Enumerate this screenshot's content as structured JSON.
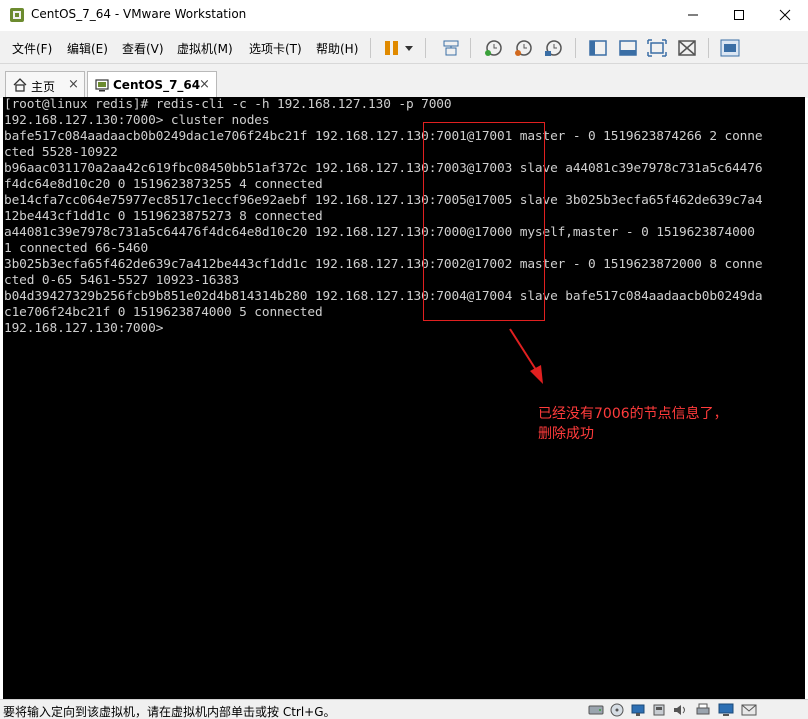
{
  "window": {
    "title": "CentOS_7_64 - VMware Workstation",
    "controls": {
      "minimize": "minimize",
      "maximize": "maximize",
      "close": "close"
    }
  },
  "menubar": {
    "items": [
      {
        "label": "文件(F)"
      },
      {
        "label": "编辑(E)"
      },
      {
        "label": "查看(V)"
      },
      {
        "label": "虚拟机(M)"
      },
      {
        "label": "选项卡(T)"
      },
      {
        "label": "帮助(H)"
      }
    ],
    "toolbar_icons": [
      "pause-icon",
      "dropdown-icon",
      "send-ctrl-alt-del-icon",
      "snapshot-icon",
      "revert-snapshot-icon",
      "snapshot-manager-icon",
      "sidebar-icon",
      "console-view-icon",
      "fullscreen-icon",
      "unity-icon",
      "thumbnail-icon"
    ]
  },
  "tabs": [
    {
      "label": "主页",
      "icon": "home-icon",
      "active": false
    },
    {
      "label": "CentOS_7_64",
      "icon": "vm-icon",
      "active": true
    }
  ],
  "tab_close": "×",
  "terminal": {
    "lines": [
      "[root@linux redis]# redis-cli -c -h 192.168.127.130 -p 7000",
      "192.168.127.130:7000> cluster nodes",
      "bafe517c084aadaacb0b0249dac1e706f24bc21f 192.168.127.130:7001@17001 master - 0 1519623874266 2 conne",
      "cted 5528-10922",
      "b96aac031170a2aa42c619fbc08450bb51af372c 192.168.127.130:7003@17003 slave a44081c39e7978c731a5c64476",
      "f4dc64e8d10c20 0 1519623873255 4 connected",
      "be14cfa7cc064e75977ec8517c1eccf96e92aebf 192.168.127.130:7005@17005 slave 3b025b3ecfa65f462de639c7a4",
      "12be443cf1dd1c 0 1519623875273 8 connected",
      "a44081c39e7978c731a5c64476f4dc64e8d10c20 192.168.127.130:7000@17000 myself,master - 0 1519623874000",
      "1 connected 66-5460",
      "3b025b3ecfa65f462de639c7a412be443cf1dd1c 192.168.127.130:7002@17002 master - 0 1519623872000 8 conne",
      "cted 0-65 5461-5527 10923-16383",
      "b04d39427329b256fcb9b851e02d4b814314b280 192.168.127.130:7004@17004 slave bafe517c084aadaacb0b0249da",
      "c1e706f24bc21f 0 1519623874000 5 connected",
      "192.168.127.130:7000>"
    ]
  },
  "annotation": {
    "line1": "已经没有7006的节点信息了，",
    "line2": "删除成功",
    "color": "#ff3b3b"
  },
  "statusbar": {
    "text": "要将输入定向到该虚拟机，请在虚拟机内部单击或按 Ctrl+G。",
    "icons": [
      "hard-disk-icon",
      "cd-rom-icon",
      "network-icon",
      "usb-icon",
      "sound-icon",
      "printer-icon",
      "display-icon",
      "message-icon"
    ]
  },
  "colors": {
    "terminal_bg": "#000000",
    "terminal_fg": "#cfcfcf",
    "highlight": "#e02020"
  }
}
